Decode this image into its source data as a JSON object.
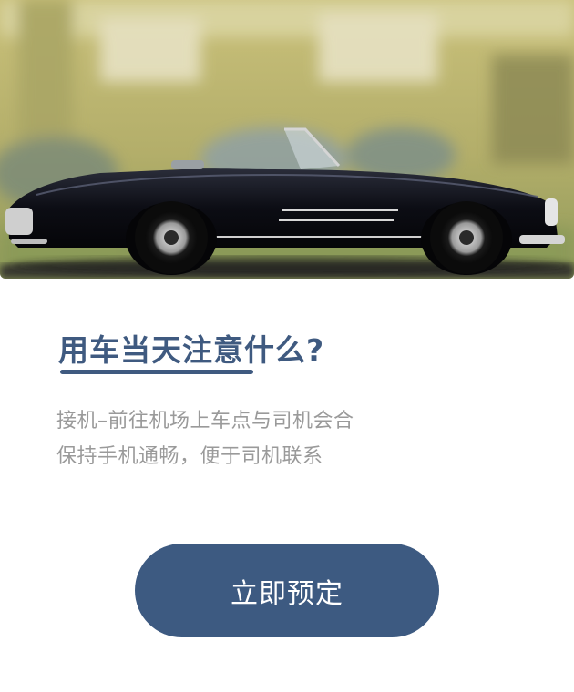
{
  "hero": {
    "image": "vintage-black-convertible-car-photo"
  },
  "card": {
    "title": "用车当天注意什么?",
    "tips": [
      "接机–前往机场上车点与司机会合",
      "保持手机通畅，便于司机联系"
    ],
    "book_button_label": "立即预定"
  },
  "colors": {
    "accent": "#3d5a81",
    "title": "#3f5a80",
    "tip_text": "#9a9a9a",
    "background": "#ffffff"
  }
}
